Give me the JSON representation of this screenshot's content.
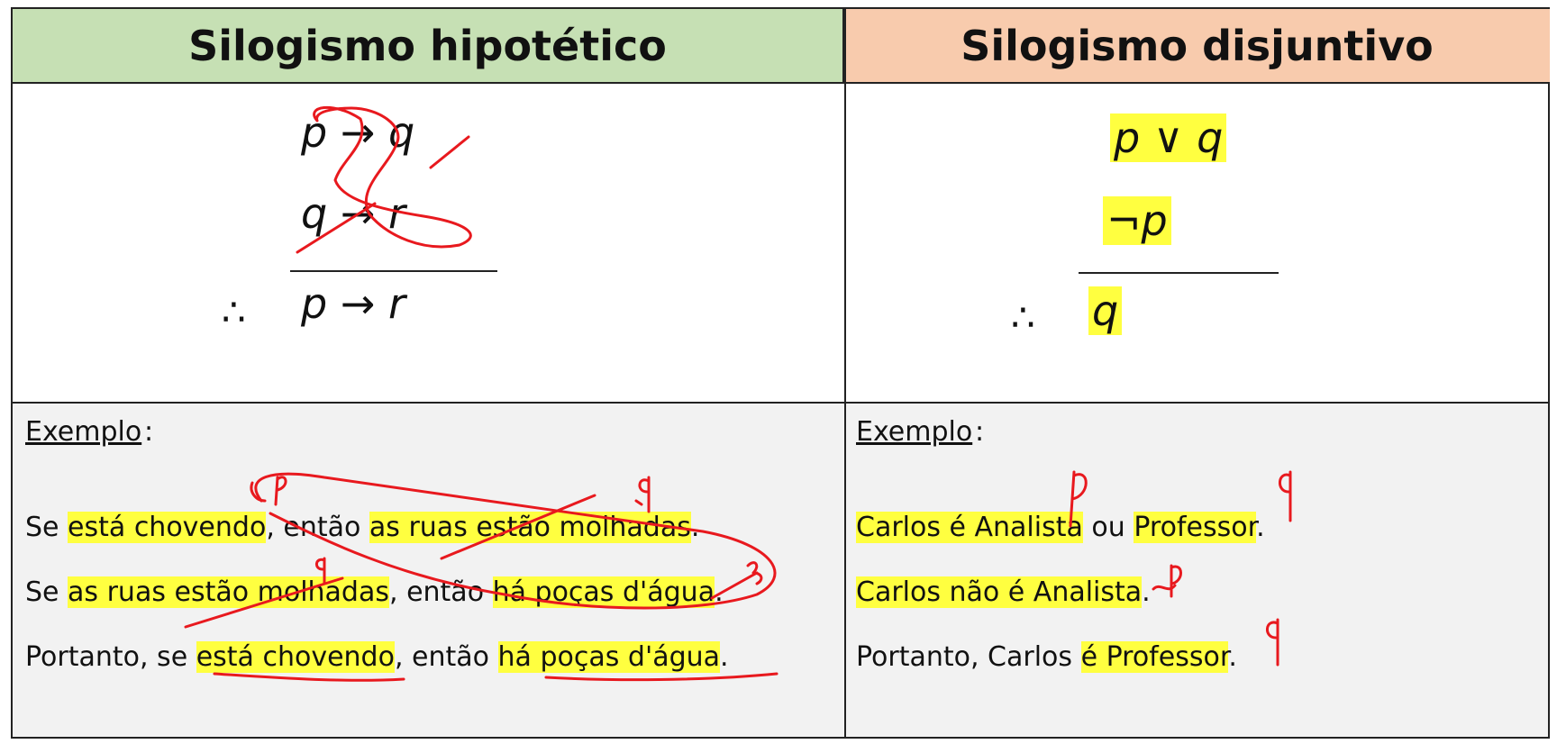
{
  "left": {
    "title": "Silogismo hipotético",
    "premise1": "p → q",
    "premise2": "q → r",
    "therefore": "∴",
    "conclusion": "p → r",
    "example_label": "Exemplo",
    "colon": ":",
    "lines": [
      {
        "a": "Se ",
        "b": "está chovendo",
        "c": ", então ",
        "d": "as ruas estão molhadas",
        "e": "."
      },
      {
        "a": "Se ",
        "b": "as ruas estão molhadas",
        "c": ", então ",
        "d": "há poças d'água",
        "e": "."
      },
      {
        "a": "Portanto, se ",
        "b": "está chovendo",
        "c": ", então ",
        "d": "há poças d'água",
        "e": "."
      }
    ]
  },
  "right": {
    "title": "Silogismo disjuntivo",
    "premise1": "p ∨ q",
    "premise2": "¬p",
    "therefore": "∴",
    "conclusion": "q",
    "example_label": "Exemplo",
    "colon": ":",
    "lines": [
      {
        "a": "",
        "b": "Carlos é Analista",
        "c": " ou ",
        "d": "Professor",
        "e": "."
      },
      {
        "a": "",
        "b": "Carlos não é Analista",
        "c": "",
        "d": "",
        "e": "."
      },
      {
        "a": "Portanto, Carlos ",
        "b": "é Professor",
        "c": "",
        "d": "",
        "e": "."
      }
    ]
  },
  "colors": {
    "highlight": "#ffff40",
    "ink": "#e8191e",
    "left_header": "#c6e0b4",
    "right_header": "#f8cbad"
  }
}
